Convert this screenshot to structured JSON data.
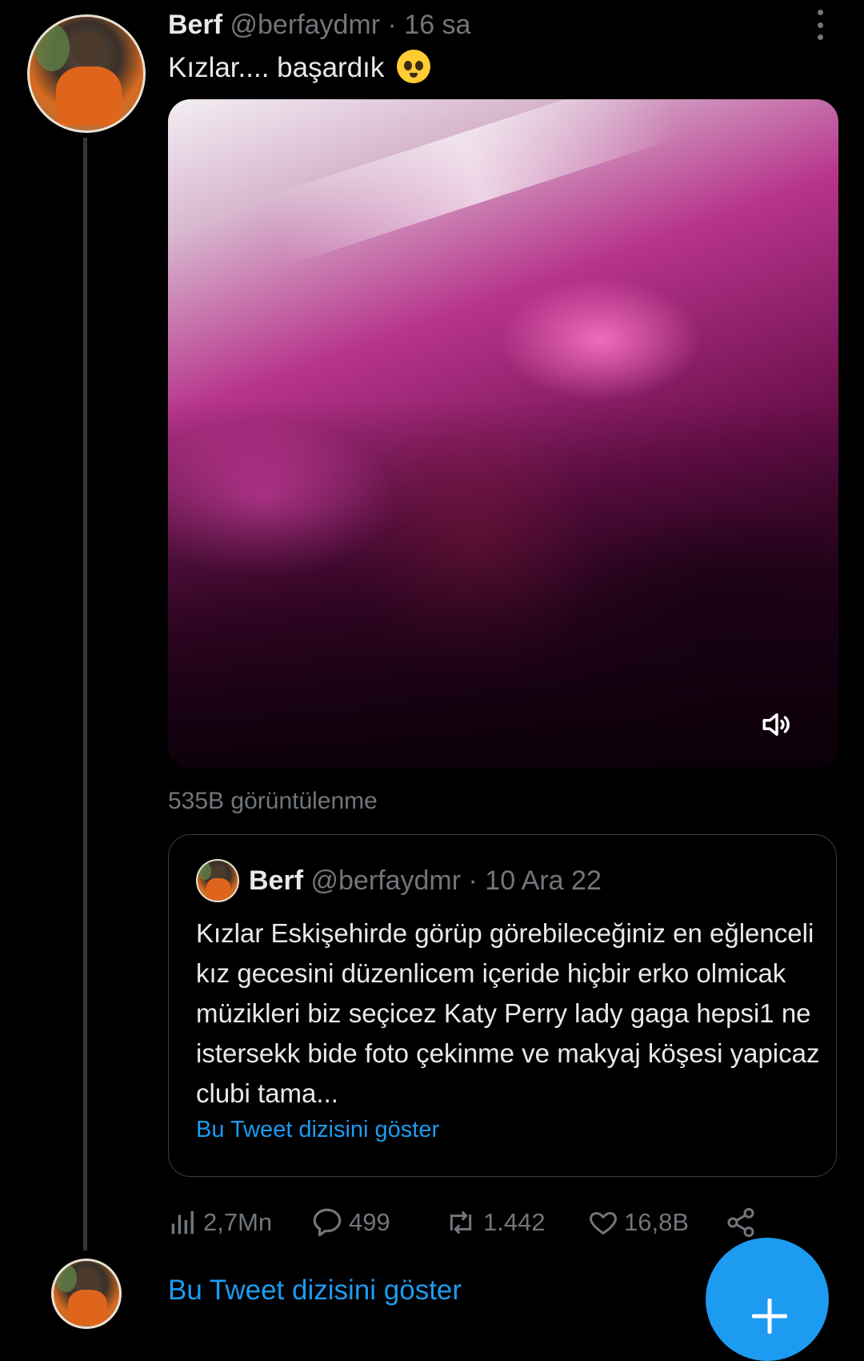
{
  "tweet": {
    "display_name": "Berf",
    "handle": "@berfaydmr",
    "separator": "·",
    "time": "16 sa",
    "text": "Kızlar.... başardık",
    "emoji": "pleading-face-icon",
    "views": "535B görüntülenme"
  },
  "quoted_tweet": {
    "display_name": "Berf",
    "handle": "@berfaydmr",
    "separator": "·",
    "date": "10 Ara 22",
    "text": "Kızlar Eskişehirde görüp görebileceğiniz en eğlenceli kız gecesini düzenlicem içeride hiçbir erko olmicak müzikleri biz seçicez Katy Perry lady gaga hepsi1 ne istersekk bide foto çekinme ve makyaj köşesi yapicaz clubi tama...",
    "show_thread": "Bu Tweet dizisini göster"
  },
  "actions": {
    "analytics_count": "2,7Mn",
    "reply_count": "499",
    "retweet_count": "1.442",
    "like_count": "16,8B"
  },
  "thread_link": "Bu Tweet dizisini göster",
  "colors": {
    "accent": "#1d9bf0",
    "muted": "#71767b",
    "background": "#000000"
  }
}
